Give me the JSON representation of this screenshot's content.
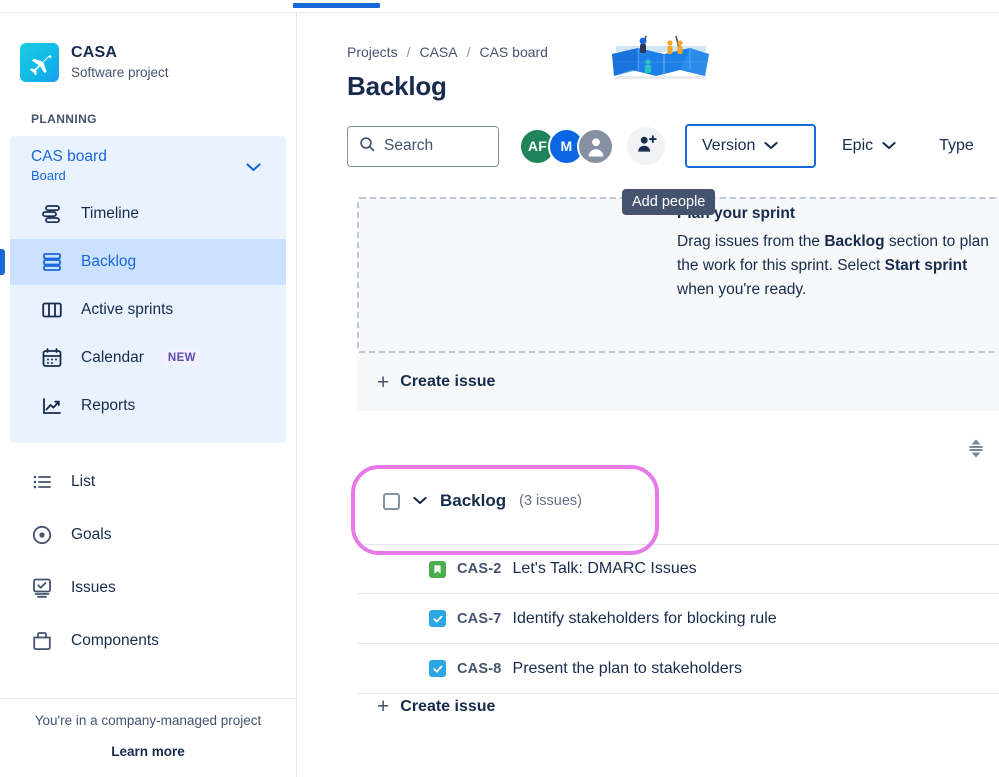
{
  "topbar": {
    "tab_indicator": "active-tab"
  },
  "sidebar": {
    "project": {
      "name": "CASA",
      "type": "Software project",
      "icon": "airplane-icon"
    },
    "section_label": "PLANNING",
    "board_switcher": {
      "title": "CAS board",
      "subtitle": "Board",
      "icon": "chevron-down-icon"
    },
    "primary_items": [
      {
        "label": "Timeline",
        "icon": "timeline-icon",
        "active": false
      },
      {
        "label": "Backlog",
        "icon": "backlog-icon",
        "active": true
      },
      {
        "label": "Active sprints",
        "icon": "board-columns-icon",
        "active": false
      },
      {
        "label": "Calendar",
        "icon": "calendar-icon",
        "active": false,
        "badge": "NEW"
      },
      {
        "label": "Reports",
        "icon": "reports-icon",
        "active": false
      }
    ],
    "secondary_items": [
      {
        "label": "List",
        "icon": "list-icon"
      },
      {
        "label": "Goals",
        "icon": "goals-target-icon"
      },
      {
        "label": "Issues",
        "icon": "issues-icon"
      },
      {
        "label": "Components",
        "icon": "components-icon"
      }
    ],
    "footer": {
      "note": "You're in a company-managed project",
      "link": "Learn more"
    }
  },
  "main": {
    "breadcrumb": [
      "Projects",
      "CASA",
      "CAS board"
    ],
    "breadcrumb_separator": "/",
    "page_title": "Backlog",
    "toolbar": {
      "search_placeholder": "Search",
      "search_value": "",
      "search_icon": "search-icon",
      "avatars": [
        {
          "initials": "AF",
          "color": "#1F845A"
        },
        {
          "initials": "M",
          "color": "#0B66E4"
        },
        {
          "initials": "",
          "color": "#8590A2"
        }
      ],
      "add_people": {
        "icon": "add-person-icon",
        "tooltip": "Add people"
      },
      "filters": [
        {
          "label": "Version",
          "icon": "chevron-down-icon",
          "focused": true
        },
        {
          "label": "Epic",
          "icon": "chevron-down-icon",
          "focused": false
        },
        {
          "label": "Type",
          "icon": "",
          "focused": false
        }
      ]
    },
    "sprint_panel": {
      "hint_title": "Plan your sprint",
      "hint_body_parts": [
        {
          "text": "Drag issues from the ",
          "bold": false
        },
        {
          "text": "Backlog",
          "bold": true
        },
        {
          "text": " section to plan the work for this sprint. Select ",
          "bold": false
        },
        {
          "text": "Start sprint",
          "bold": true
        },
        {
          "text": " when you're ready.",
          "bold": false
        }
      ],
      "illustration": "map-planning-illustration",
      "create_issue_label": "Create issue",
      "plus_icon": "plus-icon"
    },
    "collapse_toggle_icon": "expand-collapse-icon",
    "backlog_section": {
      "checkbox_checked": false,
      "chevron_icon": "chevron-down-icon",
      "title": "Backlog",
      "count": "(3 issues)",
      "highlight_color": "#E879E8",
      "issues": [
        {
          "key": "CAS-2",
          "summary": "Let's Talk: DMARC Issues",
          "type": "story",
          "type_color": "#4BAD4B"
        },
        {
          "key": "CAS-7",
          "summary": "Identify stakeholders for blocking rule",
          "type": "task",
          "type_color": "#2BA7E3"
        },
        {
          "key": "CAS-8",
          "summary": "Present the plan to stakeholders",
          "type": "task",
          "type_color": "#2BA7E3"
        }
      ],
      "create_issue_label": "Create issue",
      "plus_icon": "plus-icon"
    }
  }
}
